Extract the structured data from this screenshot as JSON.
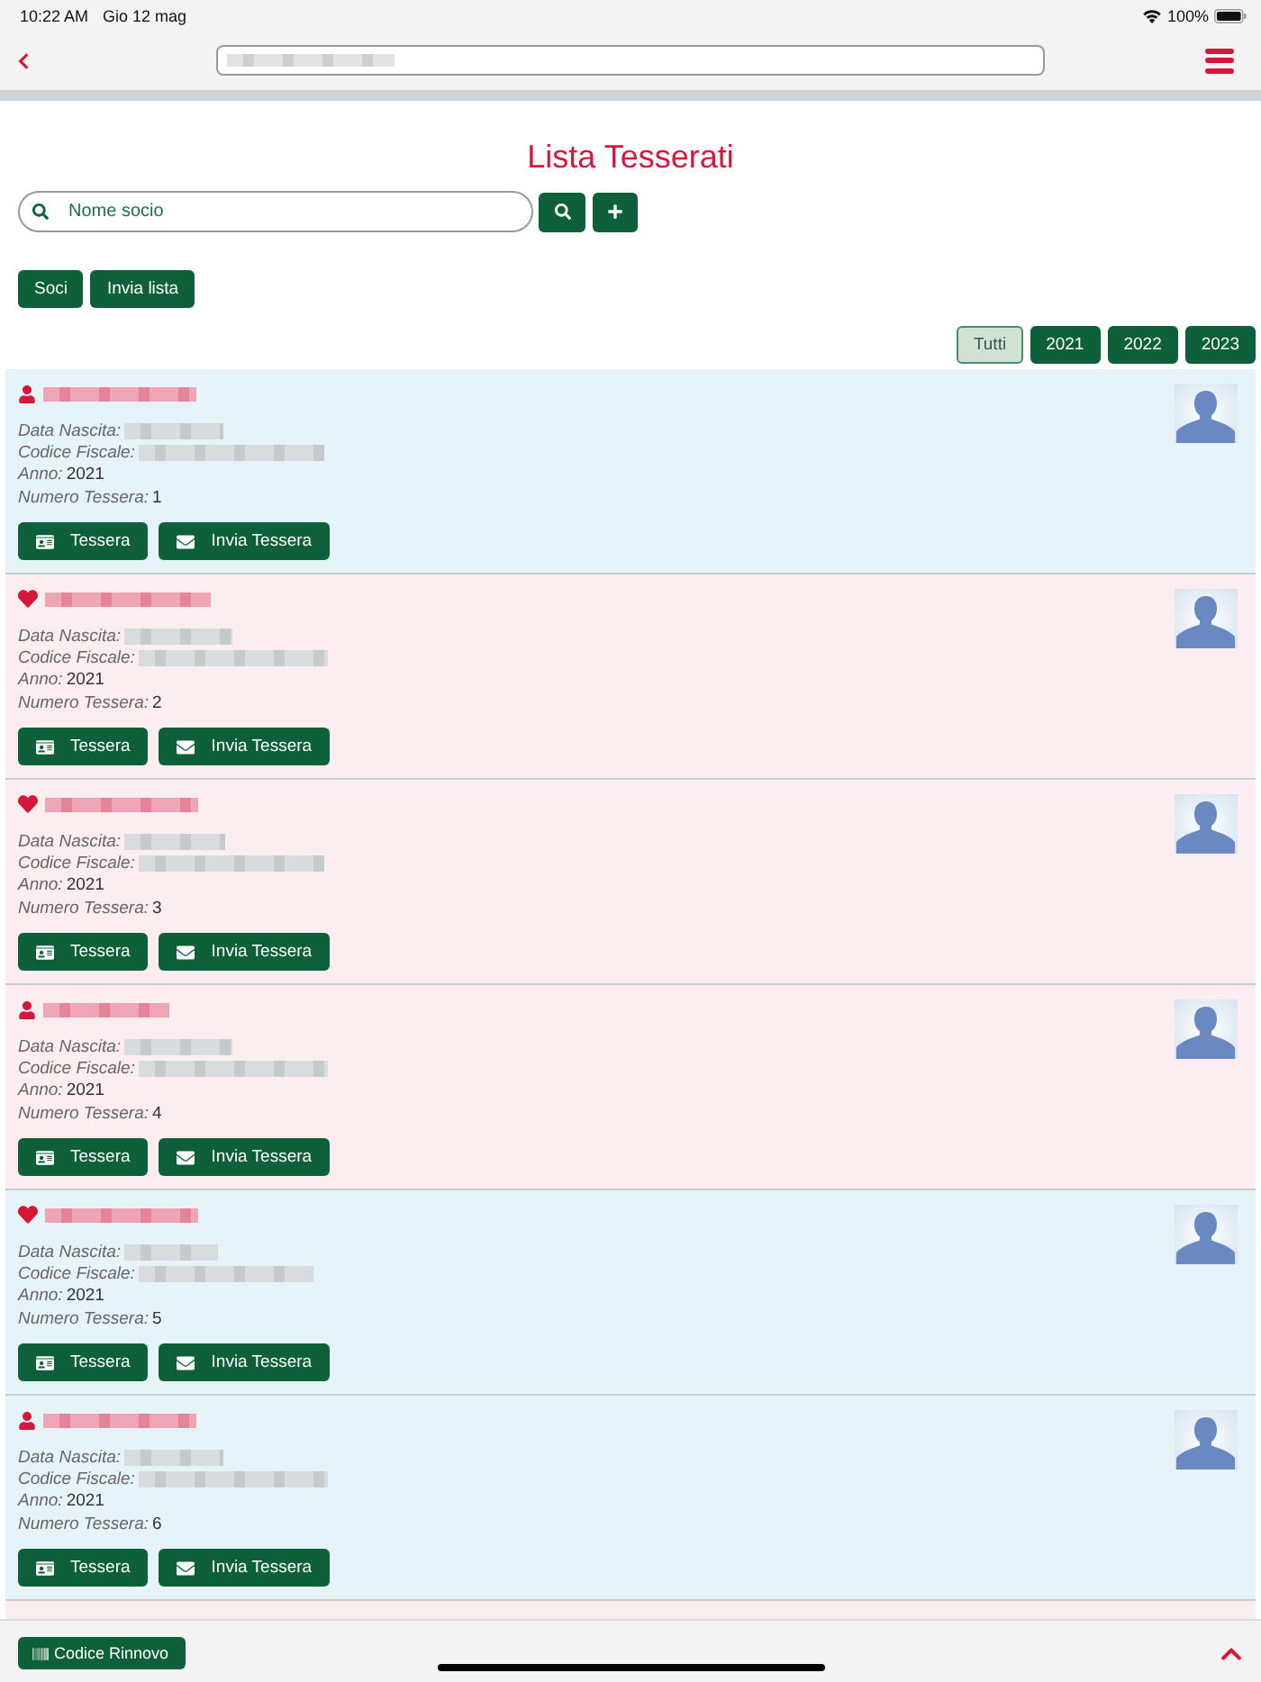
{
  "status_bar": {
    "time": "10:22 AM",
    "date": "Gio 12 mag",
    "battery": "100%"
  },
  "page": {
    "title": "Lista Tesserati",
    "search": {
      "placeholder": "Nome socio"
    },
    "actions": [
      "Soci",
      "Invia lista"
    ],
    "year_filters": [
      {
        "label": "Tutti",
        "selected": true
      },
      {
        "label": "2021",
        "selected": false
      },
      {
        "label": "2022",
        "selected": false
      },
      {
        "label": "2023",
        "selected": false
      }
    ]
  },
  "cards": [
    {
      "kind": "person",
      "color": "#e6f3f8",
      "fields": [
        {
          "label": "Data Nascita:",
          "redacted": true
        },
        {
          "label": "Codice Fiscale:",
          "redacted": true
        },
        {
          "label": "Anno:",
          "value": "2021",
          "redacted": false
        },
        {
          "label": "Numero Tessera:",
          "value": "1",
          "redacted": false
        }
      ],
      "buttons": [
        {
          "kind": "card",
          "label": "Tessera"
        },
        {
          "kind": "mail",
          "label": "Invia Tessera"
        }
      ]
    },
    {
      "kind": "heart",
      "color": "#fcedf0",
      "fields": [
        {
          "label": "Data Nascita:",
          "redacted": true
        },
        {
          "label": "Codice Fiscale:",
          "redacted": true
        },
        {
          "label": "Anno:",
          "value": "2021",
          "redacted": false
        },
        {
          "label": "Numero Tessera:",
          "value": "2",
          "redacted": false
        }
      ],
      "buttons": [
        {
          "kind": "card",
          "label": "Tessera"
        },
        {
          "kind": "mail",
          "label": "Invia Tessera"
        }
      ]
    },
    {
      "kind": "heart",
      "color": "#fcedf0",
      "fields": [
        {
          "label": "Data Nascita:",
          "redacted": true
        },
        {
          "label": "Codice Fiscale:",
          "redacted": true
        },
        {
          "label": "Anno:",
          "value": "2021",
          "redacted": false
        },
        {
          "label": "Numero Tessera:",
          "value": "3",
          "redacted": false
        }
      ],
      "buttons": [
        {
          "kind": "card",
          "label": "Tessera"
        },
        {
          "kind": "mail",
          "label": "Invia Tessera"
        }
      ]
    },
    {
      "kind": "person",
      "color": "#fcedf0",
      "fields": [
        {
          "label": "Data Nascita:",
          "redacted": true
        },
        {
          "label": "Codice Fiscale:",
          "redacted": true
        },
        {
          "label": "Anno:",
          "value": "2021",
          "redacted": false
        },
        {
          "label": "Numero Tessera:",
          "value": "4",
          "redacted": false
        }
      ],
      "buttons": [
        {
          "kind": "card",
          "label": "Tessera"
        },
        {
          "kind": "mail",
          "label": "Invia Tessera"
        }
      ]
    },
    {
      "kind": "heart",
      "color": "#e6f3f8",
      "fields": [
        {
          "label": "Data Nascita:",
          "redacted": true
        },
        {
          "label": "Codice Fiscale:",
          "redacted": true
        },
        {
          "label": "Anno:",
          "value": "2021",
          "redacted": false
        },
        {
          "label": "Numero Tessera:",
          "value": "5",
          "redacted": false
        }
      ],
      "buttons": [
        {
          "kind": "card",
          "label": "Tessera"
        },
        {
          "kind": "mail",
          "label": "Invia Tessera"
        }
      ]
    },
    {
      "kind": "person",
      "color": "#e6f3f8",
      "fields": [
        {
          "label": "Data Nascita:",
          "redacted": true
        },
        {
          "label": "Codice Fiscale:",
          "redacted": true
        },
        {
          "label": "Anno:",
          "value": "2021",
          "redacted": false
        },
        {
          "label": "Numero Tessera:",
          "value": "6",
          "redacted": false
        }
      ],
      "buttons": [
        {
          "kind": "card",
          "label": "Tessera"
        },
        {
          "kind": "mail",
          "label": "Invia Tessera"
        }
      ]
    },
    {
      "kind": "partial",
      "color": "#fcedf0"
    }
  ],
  "footer": {
    "button": "Codice Rinnovo"
  }
}
